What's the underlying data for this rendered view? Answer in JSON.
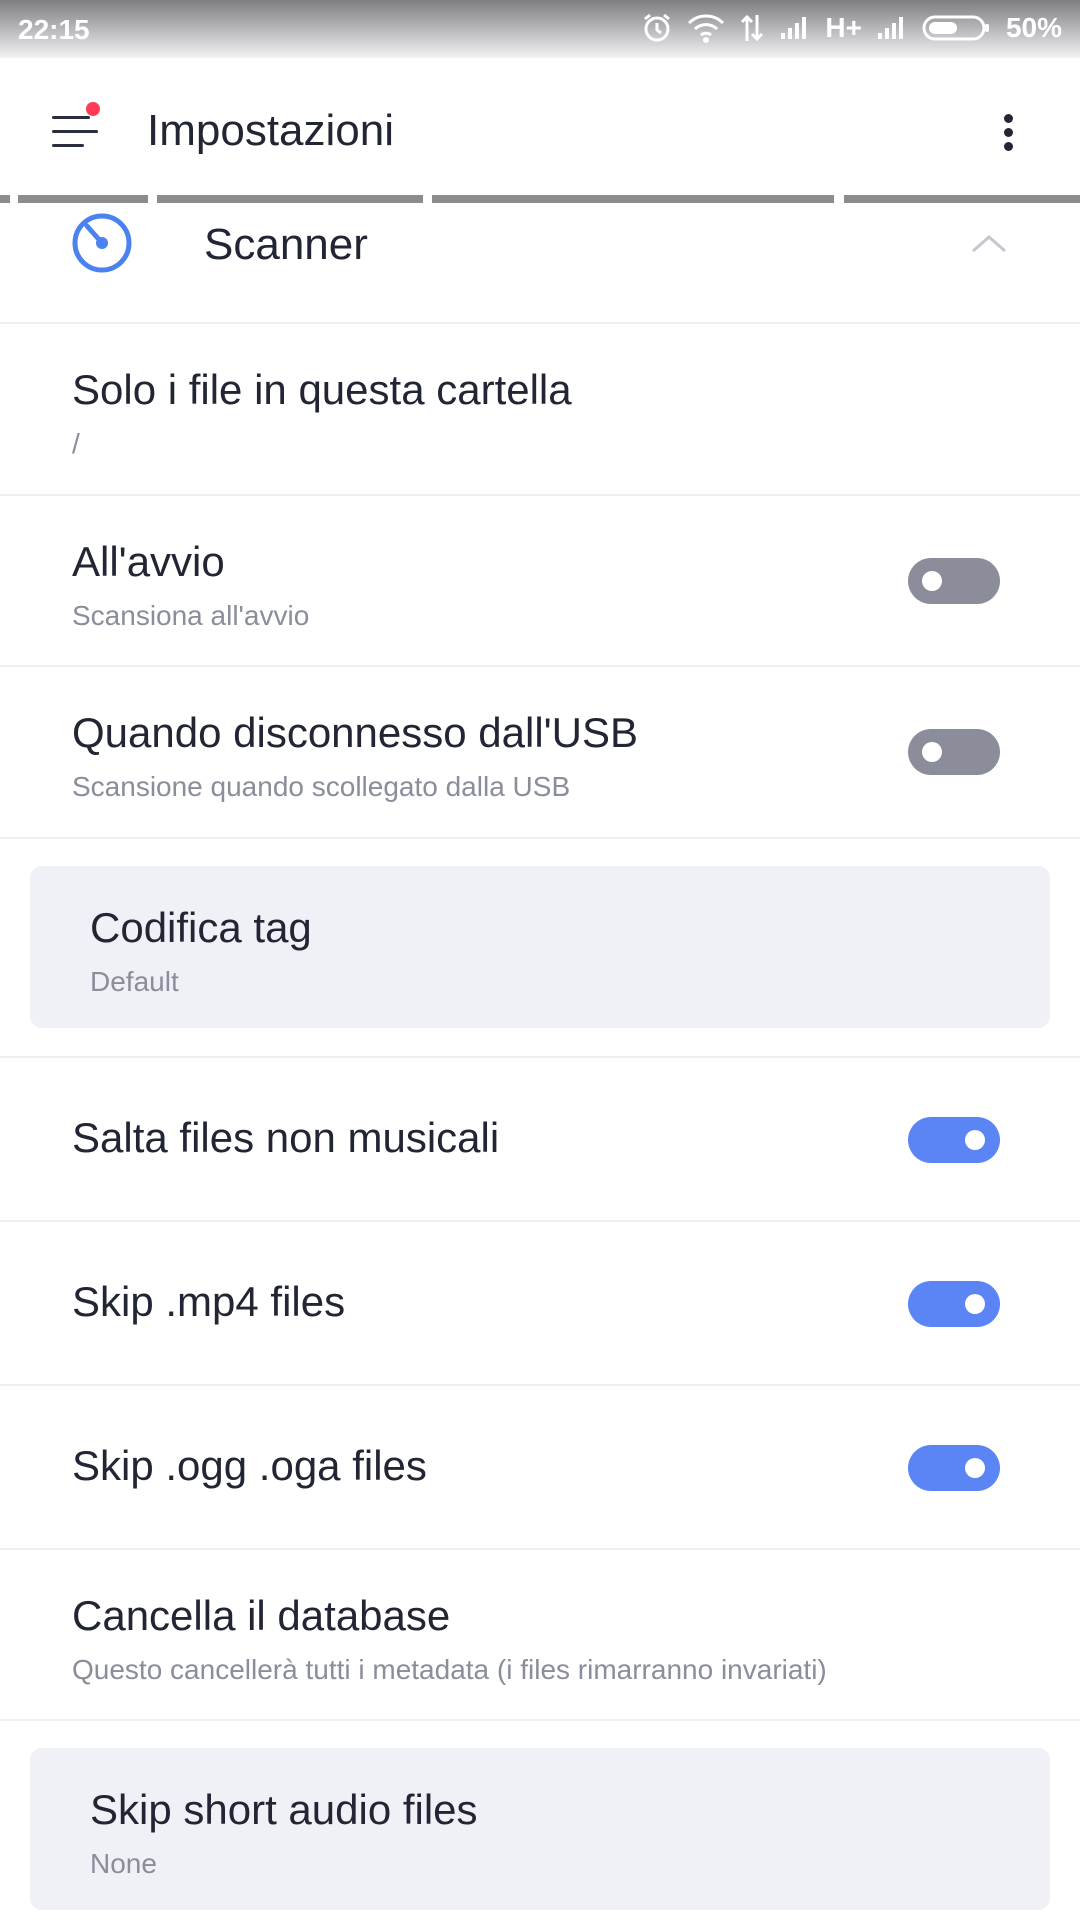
{
  "status_bar": {
    "time": "22:15",
    "network": "H+",
    "battery": "50%"
  },
  "app_bar": {
    "title": "Impostazioni"
  },
  "category": {
    "label": "Scanner",
    "accent": "#4a82f0"
  },
  "prefs": {
    "folder": {
      "title": "Solo i file in questa cartella",
      "summary": "/"
    },
    "on_start": {
      "title": "All'avvio",
      "summary": "Scansiona all'avvio",
      "enabled": false
    },
    "on_usb": {
      "title": "Quando disconnesso dall'USB",
      "summary": "Scansione quando scollegato dalla USB",
      "enabled": false
    },
    "tag_encoding": {
      "title": "Codifica tag",
      "summary": "Default"
    },
    "skip_non_music": {
      "title": "Salta files non musicali",
      "enabled": true
    },
    "skip_mp4": {
      "title": "Skip .mp4 files",
      "enabled": true
    },
    "skip_ogg": {
      "title": "Skip .ogg .oga files",
      "enabled": true
    },
    "clear_db": {
      "title": "Cancella il database",
      "summary": "Questo cancellerà tutti i metadata (i files rimarranno invariati)"
    },
    "skip_short": {
      "title": "Skip short audio files",
      "summary": "None"
    }
  },
  "colors": {
    "toggle_on": "#5b84f5",
    "toggle_off": "#8b8d9b",
    "notification_dot": "#ff3b57"
  }
}
